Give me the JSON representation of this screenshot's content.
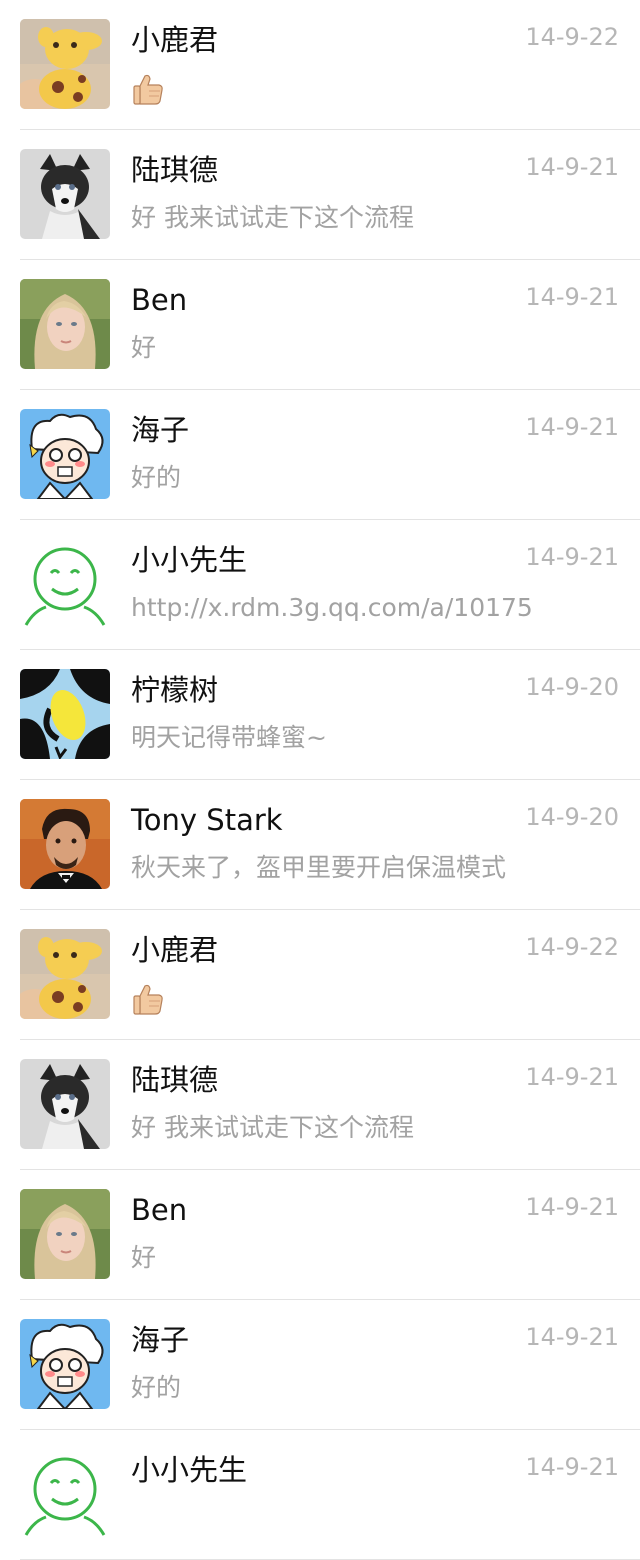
{
  "chats": [
    {
      "name": "小鹿君",
      "date": "14-9-22",
      "message": "",
      "message_icon": "thumbs-up-icon",
      "avatar": "giraffe-avatar"
    },
    {
      "name": "陆琪德",
      "date": "14-9-21",
      "message": "好 我来试试走下这个流程",
      "avatar": "husky-avatar"
    },
    {
      "name": "Ben",
      "date": "14-9-21",
      "message": "好",
      "avatar": "blonde-woman-avatar"
    },
    {
      "name": "海子",
      "date": "14-9-21",
      "message": "好的",
      "avatar": "cartoon-boy-avatar"
    },
    {
      "name": "小小先生",
      "date": "14-9-21",
      "message": "http://x.rdm.3g.qq.com/a/10175",
      "avatar": "green-smiley-avatar"
    },
    {
      "name": "柠檬树",
      "date": "14-9-20",
      "message": "明天记得带蜂蜜~",
      "avatar": "lemon-avatar"
    },
    {
      "name": "Tony Stark",
      "date": "14-9-20",
      "message": "秋天来了，盔甲里要开启保温模式",
      "avatar": "tony-stark-avatar"
    },
    {
      "name": "小鹿君",
      "date": "14-9-22",
      "message": "",
      "message_icon": "thumbs-up-icon",
      "avatar": "giraffe-avatar"
    },
    {
      "name": "陆琪德",
      "date": "14-9-21",
      "message": "好 我来试试走下这个流程",
      "avatar": "husky-avatar"
    },
    {
      "name": "Ben",
      "date": "14-9-21",
      "message": "好",
      "avatar": "blonde-woman-avatar"
    },
    {
      "name": "海子",
      "date": "14-9-21",
      "message": "好的",
      "avatar": "cartoon-boy-avatar"
    },
    {
      "name": "小小先生",
      "date": "14-9-21",
      "message": "",
      "avatar": "green-smiley-avatar"
    }
  ],
  "colors": {
    "name": "#111111",
    "date": "#b6b6b6",
    "preview": "#a2a2a2",
    "divider": "#e3e3e3",
    "smiley_green": "#3cb64a"
  }
}
